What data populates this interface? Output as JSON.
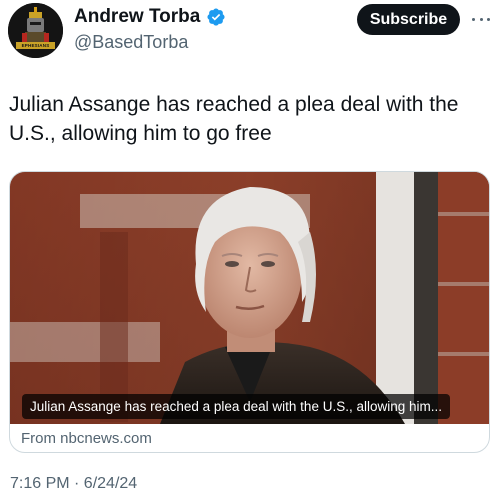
{
  "author": {
    "display_name": "Andrew Torba",
    "handle": "@BasedTorba",
    "avatar_text": "EPHESIANS 6:12"
  },
  "header": {
    "subscribe_label": "Subscribe",
    "more_icon": "more-horizontal-icon",
    "verified_icon": "verified-badge-icon"
  },
  "tweet": {
    "text": "Julian Assange has reached a plea deal with the U.S., allowing him to go free",
    "timestamp": "7:16 PM · 6/24/24"
  },
  "card": {
    "caption": "Julian Assange has reached a plea deal with the U.S., allowing him...",
    "source": "From nbcnews.com"
  },
  "colors": {
    "text_primary": "#0f1419",
    "text_secondary": "#536471",
    "verified_blue": "#1d9bf0",
    "button_bg": "#0f1419",
    "card_border": "#cfd9de"
  }
}
